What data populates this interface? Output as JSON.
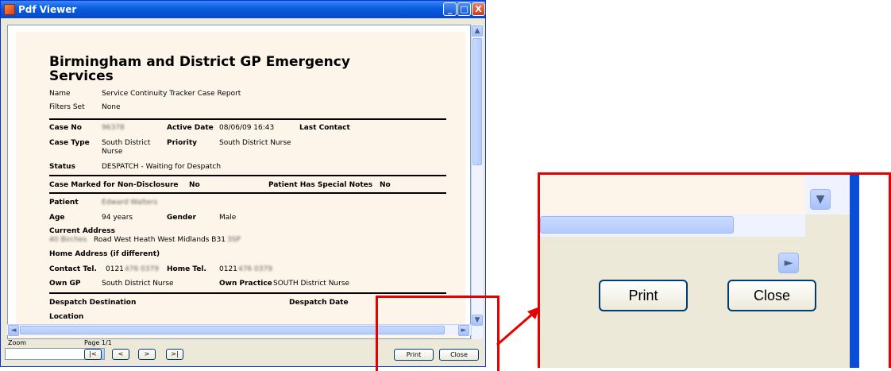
{
  "window": {
    "title": "Pdf Viewer",
    "minimize": "_",
    "maximize": "□",
    "close": "X"
  },
  "report": {
    "heading_line1": "Birmingham and District GP Emergency",
    "heading_line2": "Services",
    "name_label": "Name",
    "name_value": "Service Continuity Tracker Case Report",
    "filters_label": "Filters Set",
    "filters_value": "None",
    "case_no_label": "Case No",
    "case_no_value": "96378",
    "active_date_label": "Active Date",
    "active_date_value": "08/06/09 16:43",
    "last_contact_label": "Last Contact",
    "case_type_label": "Case Type",
    "case_type_value_1": "South District",
    "case_type_value_2": "Nurse",
    "priority_label": "Priority",
    "priority_value": "South District Nurse",
    "status_label": "Status",
    "status_value": "DESPATCH -  Waiting for Despatch",
    "nondisclosure_label": "Case Marked for Non-Disclosure",
    "nondisclosure_value": "No",
    "special_notes_label": "Patient Has Special Notes",
    "special_notes_value": "No",
    "patient_label": "Patient",
    "patient_value": "Edward Walters",
    "age_label": "Age",
    "age_value": "94 years",
    "gender_label": "Gender",
    "gender_value": "Male",
    "current_address_label": "Current Address",
    "current_address_blur": "40 Birches",
    "current_address_value": "Road   West Heath West Midlands B31",
    "current_address_blur2": "3SP",
    "home_address_label": "Home Address (if different)",
    "contact_label": "Contact Tel.",
    "contact_prefix": "0121",
    "contact_blur": "476 0379",
    "home_tel_label": "Home Tel.",
    "home_tel_prefix": "0121",
    "home_tel_blur": "476 0379",
    "own_gp_label": "Own GP",
    "own_gp_value": "South District Nurse",
    "own_practice_label": "Own Practice",
    "own_practice_value": "SOUTH District Nurse",
    "despatch_dest_label": "Despatch Destination",
    "despatch_date_label": "Despatch Date",
    "location_label": "Location"
  },
  "scroll": {
    "up": "▲",
    "down": "▼",
    "left": "◄",
    "right": "►"
  },
  "bottom": {
    "zoom_label": "Zoom",
    "zoom_value": "",
    "zoom_arrow": "▼",
    "page_label": "Page 1/1",
    "first": "|<",
    "prev": "<",
    "next": ">",
    "last": ">|",
    "print": "Print",
    "close": "Close"
  },
  "zoom_view": {
    "print": "Print",
    "close": "Close",
    "dd_arrow": "▼",
    "right_arrow": "►"
  },
  "colors": {
    "highlight": "#e60000",
    "title_bar": "#0a5fe0",
    "page": "#fdf5e9"
  }
}
